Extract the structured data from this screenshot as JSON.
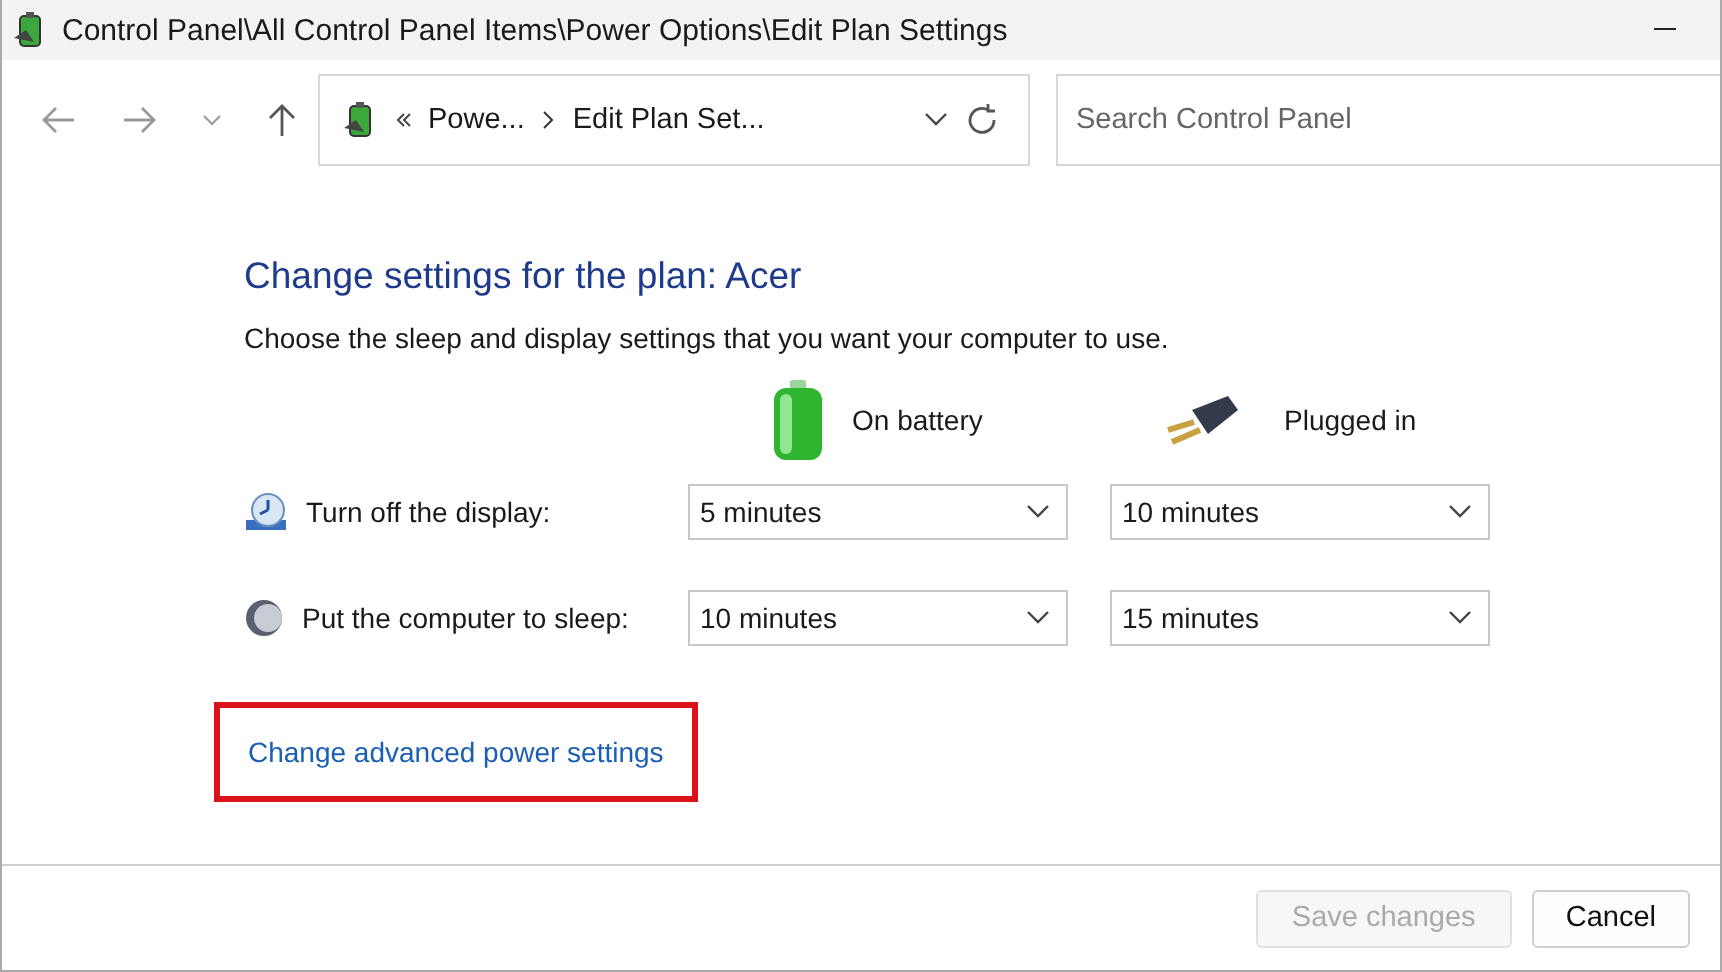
{
  "window": {
    "title": "Control Panel\\All Control Panel Items\\Power Options\\Edit Plan Settings"
  },
  "navigation": {
    "breadcrumbs": [
      "Powe...",
      "Edit Plan Set..."
    ],
    "search": {
      "placeholder": "Search Control Panel"
    }
  },
  "heading": "Change settings for the plan: Acer",
  "description": "Choose the sleep and display settings that you want your computer to use.",
  "columns": [
    {
      "kind": "battery",
      "label": "On battery"
    },
    {
      "kind": "plug",
      "label": "Plugged in"
    }
  ],
  "settings": [
    {
      "kind": "display",
      "label": "Turn off the display:",
      "values": [
        "5 minutes",
        "10 minutes"
      ]
    },
    {
      "kind": "sleep",
      "label": "Put the computer to sleep:",
      "values": [
        "10 minutes",
        "15 minutes"
      ]
    }
  ],
  "advanced_link": {
    "label": "Change advanced power settings",
    "highlighted": true
  },
  "buttons": [
    {
      "label": "Save changes",
      "disabled": true
    },
    {
      "label": "Cancel",
      "disabled": false
    }
  ]
}
